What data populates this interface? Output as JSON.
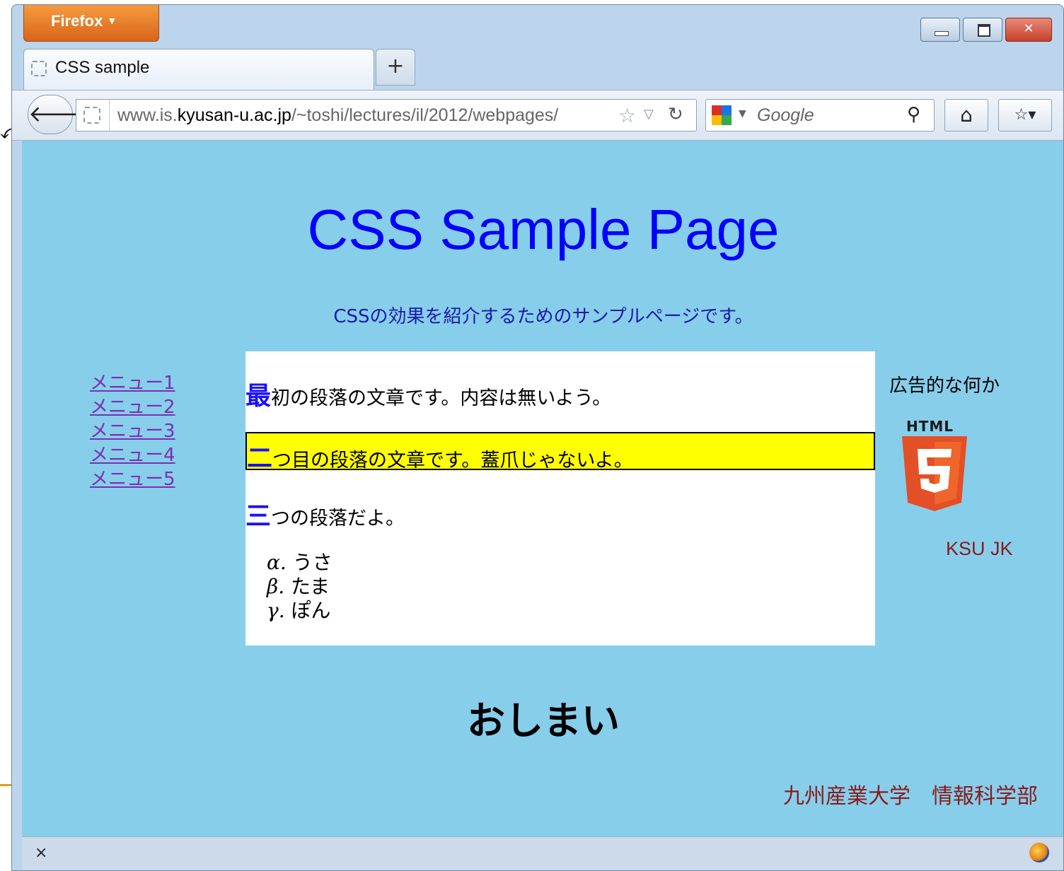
{
  "browser": {
    "app_button": "Firefox",
    "tab_title": "CSS sample",
    "new_tab": "+",
    "url": {
      "prefix": "www.is.",
      "host": "kyusan-u.ac.jp",
      "path": "/~toshi/lectures/il/2012/webpages/"
    },
    "search_placeholder": "Google",
    "status_close": "×"
  },
  "page": {
    "title": "CSS Sample Page",
    "subtitle": "CSSの効果を紹介するためのサンプルページです。",
    "menu": [
      "メニュー1",
      "メニュー2",
      "メニュー3",
      "メニュー4",
      "メニュー5"
    ],
    "paragraphs": [
      {
        "first": "最",
        "rest": "初の段落の文章です。内容は無いよう。"
      },
      {
        "first": "二",
        "rest": "つ目の段落の文章です。蓋爪じゃないよ。"
      },
      {
        "first": "三",
        "rest": "つの段落だよ。"
      }
    ],
    "list": [
      {
        "marker": "α.",
        "text": "うさ"
      },
      {
        "marker": "β.",
        "text": "たま"
      },
      {
        "marker": "γ.",
        "text": "ぽん"
      }
    ],
    "ad_text": "広告的な何か",
    "html5_label": "HTML",
    "ksu": "KSU JK",
    "closing": "おしまい",
    "footer": "九州産業大学　情報科学部"
  },
  "colors": {
    "page_background": "#87ceeb",
    "title": "#0000ff",
    "highlight_paragraph": "#ffff00",
    "first_letter": "#1a10ff",
    "menu_link": "#7b2fb3",
    "footer_text": "#8b1a1a",
    "firefox_button": "#e07a22"
  },
  "icons": {
    "back": "back-arrow-icon",
    "favicon": "page-icon",
    "bookmark_star": "star-icon",
    "reload": "reload-icon",
    "search_engine": "google-icon",
    "search": "search-icon",
    "home": "home-icon",
    "bookmarks": "bookmarks-icon",
    "html5": "html5-logo"
  }
}
